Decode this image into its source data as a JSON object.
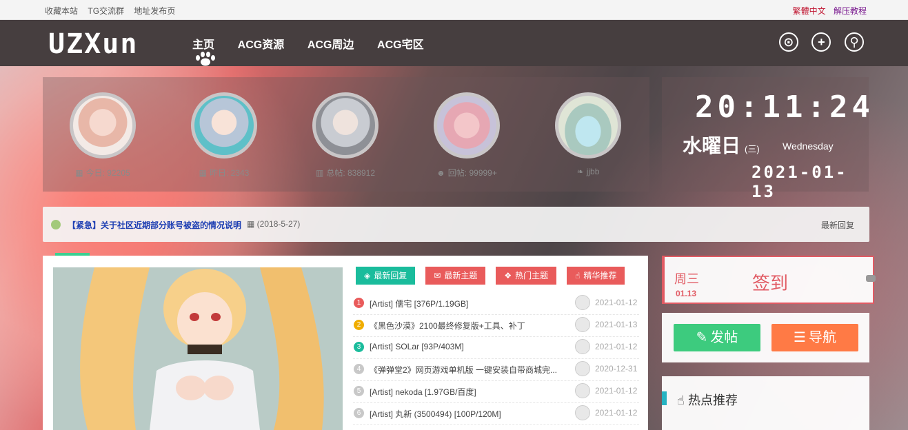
{
  "topbar": {
    "left_links": [
      "收藏本站",
      "TG交流群",
      "地址发布页"
    ],
    "right_links": [
      {
        "label": "繁體中文",
        "color": "#c0142f"
      },
      {
        "label": "解压教程",
        "color": "#7a1a8f"
      }
    ]
  },
  "nav": {
    "logo": "UZXun",
    "items": [
      "主页",
      "ACG资源",
      "ACG周边",
      "ACG宅区"
    ],
    "icons": [
      "lock-icon",
      "plus-icon",
      "search-icon"
    ]
  },
  "stats": [
    {
      "icon": "calendar-icon",
      "label": "今日: 92205"
    },
    {
      "icon": "calendar-icon",
      "label": "昨日: 2343"
    },
    {
      "icon": "bar-chart-icon",
      "label": "总帖: 838912"
    },
    {
      "icon": "users-icon",
      "label": "回帖: 99999+"
    },
    {
      "icon": "leaf-icon",
      "label": "jjbb"
    }
  ],
  "clock": {
    "time": "20:11:24",
    "weekday_jp": "水曜日",
    "weekday_cn": "(三)",
    "weekday_en": "Wednesday",
    "date": "2021-01-13"
  },
  "notice": {
    "message": "【紧急】关于社区近期部分账号被盗的情况说明",
    "date": "(2018-5-27)",
    "latest_label": "最新回复"
  },
  "tabs": [
    {
      "label": "最新回复",
      "color": "#1abc9c",
      "icon": "cube-icon"
    },
    {
      "label": "最新主题",
      "color": "#e95b5b",
      "icon": "comments-icon"
    },
    {
      "label": "热门主题",
      "color": "#e95b5b",
      "icon": "cubes-icon"
    },
    {
      "label": "精华推荐",
      "color": "#e95b5b",
      "icon": "thumbs-up-icon"
    }
  ],
  "threads": [
    {
      "n": "1",
      "color": "#e95b5b",
      "title": "[Artist] 儒宅 [376P/1.19GB]",
      "date": "2021-01-12"
    },
    {
      "n": "2",
      "color": "#f0ad00",
      "title": "《黑色沙漠》2100最终修复版+工具、补丁",
      "date": "2021-01-13"
    },
    {
      "n": "3",
      "color": "#1abc9c",
      "title": "[Artist] SOLar [93P/403M]",
      "date": "2021-01-12"
    },
    {
      "n": "4",
      "color": "#c8c8c8",
      "title": "《弹弹堂2》网页游戏单机版 一键安装自带商城完...",
      "date": "2020-12-31"
    },
    {
      "n": "5",
      "color": "#c8c8c8",
      "title": "[Artist] nekoda [1.97GB/百度]",
      "date": "2021-01-12"
    },
    {
      "n": "6",
      "color": "#c8c8c8",
      "title": "[Artist] 丸新 (3500494) [100P/120M]",
      "date": "2021-01-12"
    }
  ],
  "sign": {
    "weekday": "周三",
    "date": "01.13",
    "button": "签到"
  },
  "buttons": [
    {
      "label": "发帖",
      "color": "#3dcb7e",
      "icon": "edit-icon"
    },
    {
      "label": "导航",
      "color": "#ff7a45",
      "icon": "menu-icon"
    }
  ],
  "hot": {
    "title": "热点推荐"
  }
}
